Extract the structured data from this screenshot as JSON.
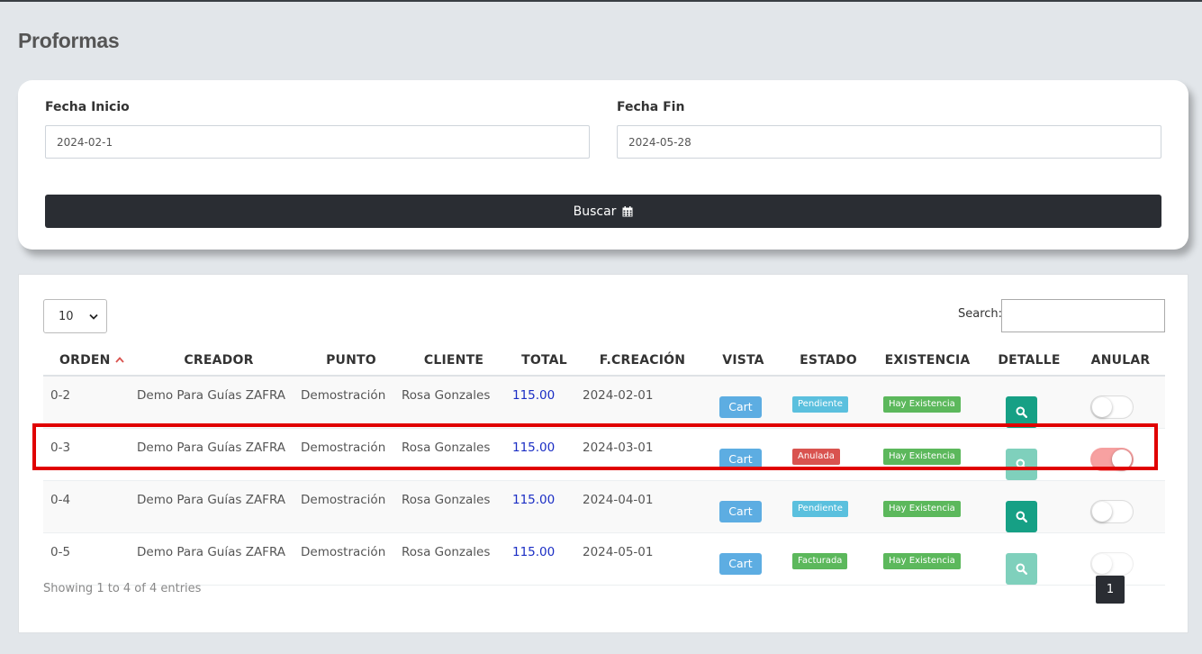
{
  "page": {
    "title": "Proformas"
  },
  "filters": {
    "start_label": "Fecha Inicio",
    "start_value": "2024-02-1",
    "end_label": "Fecha Fin",
    "end_value": "2024-05-28",
    "search_button": "Buscar",
    "search_icon": "calendar-icon"
  },
  "table_controls": {
    "length_value": "10",
    "search_label": "Search:"
  },
  "table": {
    "headers": [
      "ORDEN",
      "CREADOR",
      "PUNTO",
      "CLIENTE",
      "TOTAL",
      "F.CREACIÓN",
      "VISTA",
      "ESTADO",
      "EXISTENCIA",
      "DETALLE",
      "ANULAR"
    ],
    "sort_indicator_color": "#d9534f",
    "rows": [
      {
        "orden": "0-2",
        "creador": "Demo Para Guías ZAFRA",
        "punto": "Demostración",
        "cliente": "Rosa Gonzales",
        "total": "115.00",
        "fecha": "2024-02-01",
        "vista": "Cart",
        "estado": "Pendiente",
        "existencia": "Hay Existencia",
        "anular_on": false
      },
      {
        "orden": "0-3",
        "creador": "Demo Para Guías ZAFRA",
        "punto": "Demostración",
        "cliente": "Rosa Gonzales",
        "total": "115.00",
        "fecha": "2024-03-01",
        "vista": "Cart",
        "estado": "Anulada",
        "existencia": "Hay Existencia",
        "anular_on": true
      },
      {
        "orden": "0-4",
        "creador": "Demo Para Guías ZAFRA",
        "punto": "Demostración",
        "cliente": "Rosa Gonzales",
        "total": "115.00",
        "fecha": "2024-04-01",
        "vista": "Cart",
        "estado": "Pendiente",
        "existencia": "Hay Existencia",
        "anular_on": false
      },
      {
        "orden": "0-5",
        "creador": "Demo Para Guías ZAFRA",
        "punto": "Demostración",
        "cliente": "Rosa Gonzales",
        "total": "115.00",
        "fecha": "2024-05-01",
        "vista": "Cart",
        "estado": "Facturada",
        "existencia": "Hay Existencia",
        "anular_on": false
      }
    ]
  },
  "footer": {
    "info": "Showing 1 to 4 of 4 entries",
    "current_page": "1"
  },
  "colors": {
    "pendiente": "#5bc0de",
    "anulada": "#d9534f",
    "facturada": "#5cb85c",
    "existencia": "#5cb85c",
    "detail": "#16a085",
    "highlight": "#e00000"
  }
}
